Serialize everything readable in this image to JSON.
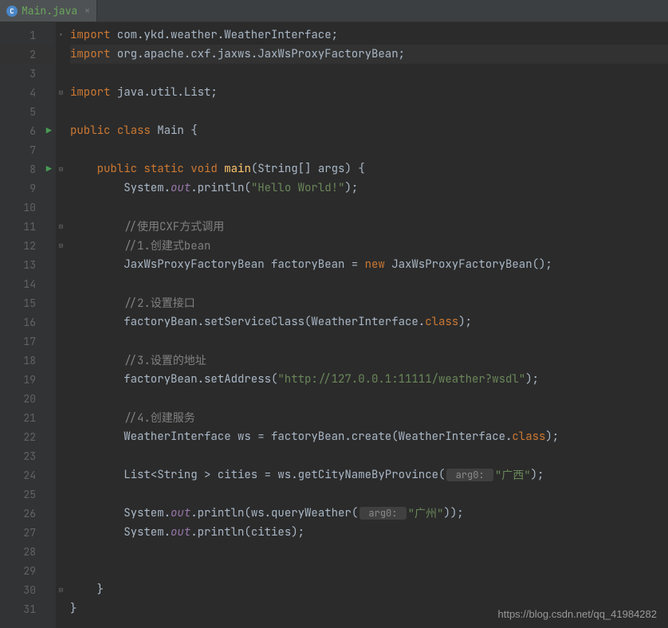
{
  "tab": {
    "title": "Main.java",
    "icon_letter": "C"
  },
  "gutter": {
    "lines": [
      "1",
      "2",
      "3",
      "4",
      "5",
      "6",
      "7",
      "8",
      "9",
      "10",
      "11",
      "12",
      "13",
      "14",
      "15",
      "16",
      "17",
      "18",
      "19",
      "20",
      "21",
      "22",
      "23",
      "24",
      "25",
      "26",
      "27",
      "28",
      "29",
      "30",
      "31"
    ]
  },
  "code": {
    "kw_import": "import",
    "kw_public": "public",
    "kw_class": "class",
    "kw_static": "static",
    "kw_void": "void",
    "kw_new": "new",
    "kw_class_ref": "class",
    "pkg1": " com.ykd.weather.WeatherInterface;",
    "pkg2": " org.apache.cxf.jaxws.JaxWsProxyFactoryBean;",
    "pkg3": " java.util.List;",
    "class_decl1": " Main {",
    "main_sig": "(String[] args) {",
    "main_name": "main",
    "sys": "System.",
    "out": "out",
    "println": ".println(",
    "hello": "\"Hello World!\"",
    "close_stmt": ");",
    "cmt1": "//使用CXF方式调用",
    "cmt2": "//1.创建式bean",
    "decl1a": "JaxWsProxyFactoryBean factoryBean = ",
    "decl1b": " JaxWsProxyFactoryBean();",
    "cmt3": "//2.设置接口",
    "setservice": "factoryBean.setServiceClass(WeatherInterface.",
    "cmt4": "//3.设置的地址",
    "setaddr_a": "factoryBean.setAddress(",
    "url": "\"http://127.0.0.1:11111/weather?wsdl\"",
    "cmt5": "//4.创建服务",
    "ws_decl": "WeatherInterface ws = factoryBean.create(WeatherInterface.",
    "list_decl_a": "List<String > cities = ws.getCityNameByProvince(",
    "hint_arg0": " arg0: ",
    "guangxi": "\"广西\"",
    "query_a": ".println(ws.queryWeather(",
    "guangzhou": "\"广州\"",
    "query_close": "));",
    "println_cities": ".println(cities);",
    "brace_close": "}"
  },
  "watermark": "https://blog.csdn.net/qq_41984282"
}
